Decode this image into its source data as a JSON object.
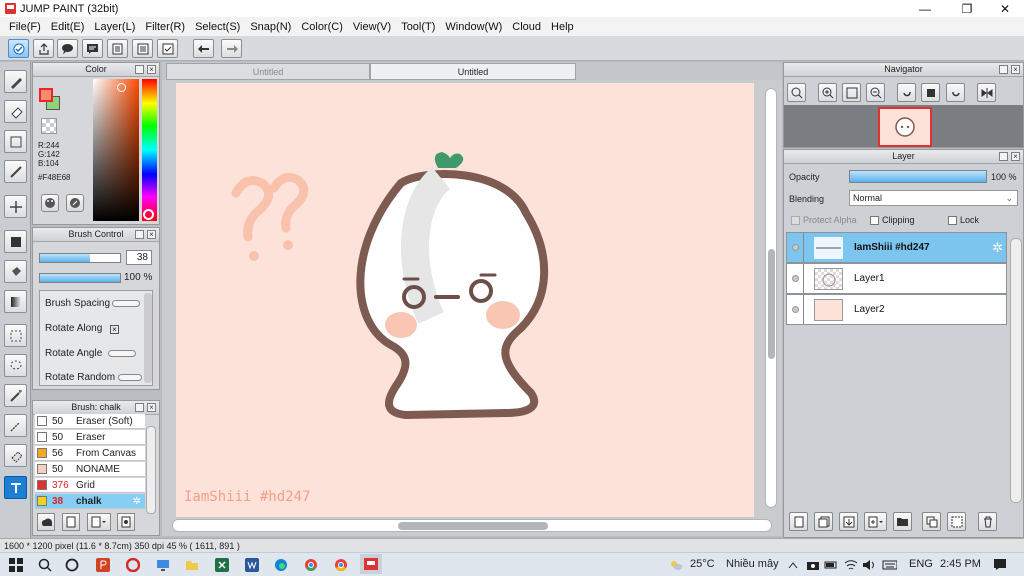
{
  "window": {
    "title": "JUMP PAINT (32bit)",
    "minimize": "—",
    "restore": "❐",
    "close": "✕"
  },
  "menu": [
    "File(F)",
    "Edit(E)",
    "Layer(L)",
    "Filter(R)",
    "Select(S)",
    "Snap(N)",
    "Color(C)",
    "View(V)",
    "Tool(T)",
    "Window(W)",
    "Cloud",
    "Help"
  ],
  "toolbar_icons": [
    "cloud-icon",
    "share-icon",
    "speech-bubble-icon",
    "comment-icon",
    "page-icon",
    "list-icon",
    "checklist-icon",
    "undo-icon",
    "redo-icon"
  ],
  "color_panel": {
    "title": "Color",
    "r": "R:244",
    "g": "G:142",
    "b": "B:104",
    "hex": "#F48E68",
    "fg": "#F48E68",
    "bg": "#8fd47a"
  },
  "brush_control": {
    "title": "Brush Control",
    "size_value": "38",
    "size_fill": 0.62,
    "opacity_value": "100 %",
    "opacity_fill": 1.0,
    "brush_spacing": "Brush Spacing",
    "rotate_along": "Rotate Along",
    "rotate_angle": "Rotate Angle",
    "rotate_random": "Rotate Random"
  },
  "brush_list": {
    "title": "Brush: chalk",
    "items": [
      {
        "size": "50",
        "name": "Eraser (Soft)",
        "swatch": "#ffffff"
      },
      {
        "size": "50",
        "name": "Eraser",
        "swatch": "#ffffff"
      },
      {
        "size": "56",
        "name": "From Canvas",
        "swatch": "#f5a623"
      },
      {
        "size": "50",
        "name": "NONAME",
        "swatch": "#f6d0c2"
      },
      {
        "size": "376",
        "name": "Grid",
        "swatch": "#e03030"
      },
      {
        "size": "38",
        "name": "chalk",
        "swatch": "#f2d024"
      }
    ]
  },
  "tabs": [
    "Untitled",
    "Untitled"
  ],
  "canvas": {
    "signature": "IamShiii #hd247"
  },
  "navigator": {
    "title": "Navigator"
  },
  "layer_panel": {
    "title": "Layer",
    "opacity_label": "Opacity",
    "opacity_value": "100 %",
    "blending_label": "Blending",
    "blending_value": "Normal",
    "protect_alpha": "Protect Alpha",
    "clipping": "Clipping",
    "lock": "Lock",
    "layers": [
      {
        "name": "IamShiii #hd247",
        "selected": true
      },
      {
        "name": "Layer1",
        "selected": false
      },
      {
        "name": "Layer2",
        "selected": false
      }
    ]
  },
  "status": {
    "text": "1600 * 1200 pixel   (11.6 * 8.7cm)   350 dpi   45 %   ( 1611, 891 )"
  },
  "taskbar": {
    "temperature": "25°C",
    "weather": "Nhiều mây",
    "lang": "ENG",
    "time": "2:45 PM"
  }
}
